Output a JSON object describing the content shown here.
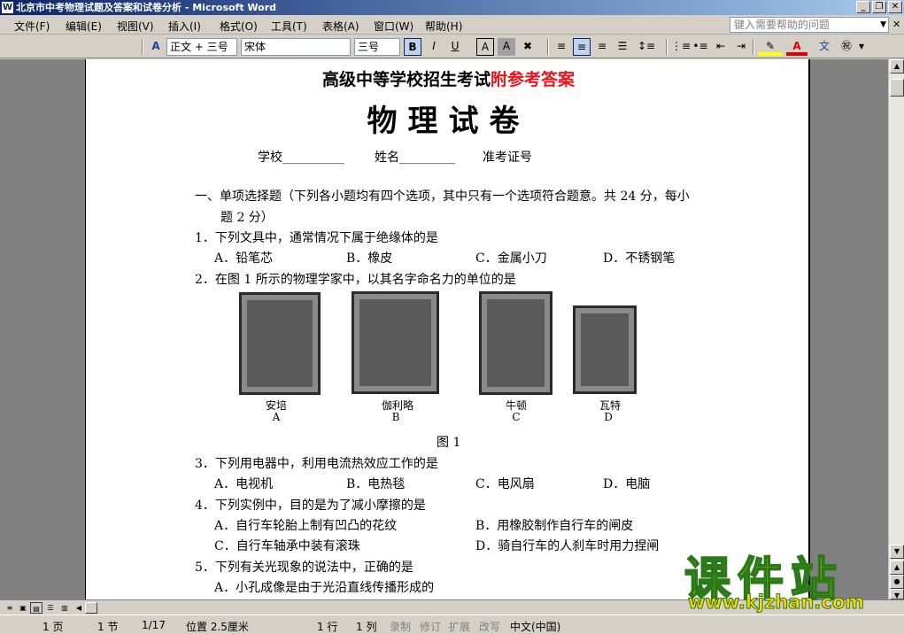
{
  "window": {
    "title": "北京市中考物理试题及答案和试卷分析 - Microsoft Word",
    "icon": "W"
  },
  "menu": [
    "文件(F)",
    "编辑(E)",
    "视图(V)",
    "插入(I)",
    "格式(O)",
    "工具(T)",
    "表格(A)",
    "窗口(W)",
    "帮助(H)"
  ],
  "help_placeholder": "键入需要帮助的问题",
  "toolbar": {
    "style": "正文 + 三号",
    "font": "宋体",
    "size": "三号",
    "bold": "B",
    "italic": "I",
    "underline": "U",
    "char_a": "A"
  },
  "doc": {
    "title_black": "高级中等学校招生考试",
    "title_red": "附参考答案",
    "heading": "物理试卷",
    "school": "学校__________",
    "name": "姓名_________",
    "exam_id": "准考证号",
    "section": "一、单项选择题（下列各小题均有四个选项，其中只有一个选项符合题意。共 24 分，每小",
    "section_cont": "题 2 分）",
    "q1": "1．下列文具中，通常情况下属于绝缘体的是",
    "q1_a": "A．铅笔芯",
    "q1_b": "B．橡皮",
    "q1_c": "C．金属小刀",
    "q1_d": "D．不锈钢笔",
    "q2": "2．在图 1 所示的物理学家中，以其名字命名力的单位的是",
    "figure_names": [
      "安培",
      "伽利略",
      "牛顿",
      "瓦特"
    ],
    "figure_letters": [
      "A",
      "B",
      "C",
      "D"
    ],
    "figure_caption": "图 1",
    "q3": "3．下列用电器中，利用电流热效应工作的是",
    "q3_a": "A．电视机",
    "q3_b": "B．电热毯",
    "q3_c": "C．电风扇",
    "q3_d": "D．电脑",
    "q4": "4．下列实例中，目的是为了减小摩擦的是",
    "q4_a": "A．自行车轮胎上制有凹凸的花纹",
    "q4_b": "B．用橡胶制作自行车的闸皮",
    "q4_c": "C．自行车轴承中装有滚珠",
    "q4_d": "D．骑自行车的人刹车时用力捏闸",
    "q5": "5．下列有关光现象的说法中，正确的是",
    "q5_a": "A．小孔成像是由于光沿直线传播形成的"
  },
  "status": {
    "page": "1 页",
    "section": "1 节",
    "pages": "1/17",
    "position": "位置 2.5厘米",
    "line": "1 行",
    "col": "1 列",
    "rec": "录制",
    "trk": "修订",
    "ext": "扩展",
    "ovr": "改写",
    "lang": "中文(中国)"
  },
  "watermark": {
    "text": "课件站",
    "url": "www.kjzhan.com"
  }
}
